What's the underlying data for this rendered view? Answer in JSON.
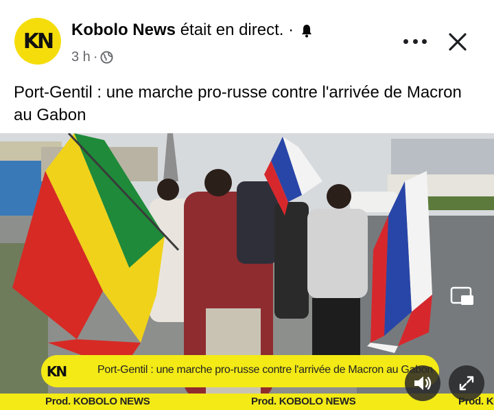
{
  "post": {
    "page_name": "Kobolo News",
    "status": "était en direct.",
    "separator": "·",
    "time": "3 h",
    "meta_separator": "·",
    "avatar_text": "KN",
    "text": "Port-Gentil : une marche pro-russe contre l'arrivée de Macron au Gabon"
  },
  "video": {
    "lower_third_logo": "KN",
    "lower_third_text": "Port-Gentil : une marche pro-russe contre l'arrivée de Macron au Gabon",
    "ticker": [
      "Prod. KOBOLO NEWS",
      "Prod. KOBOLO NEWS",
      "Prod. KC"
    ]
  },
  "icons": {
    "bell": "bell-icon",
    "globe": "globe-icon",
    "more": "more-options-icon",
    "close": "close-icon",
    "sound": "speaker-icon",
    "fullscreen": "expand-icon",
    "pip": "picture-in-picture-icon"
  },
  "colors": {
    "brand_yellow": "#f5dd0b",
    "text": "#050505",
    "meta": "#65676b"
  }
}
